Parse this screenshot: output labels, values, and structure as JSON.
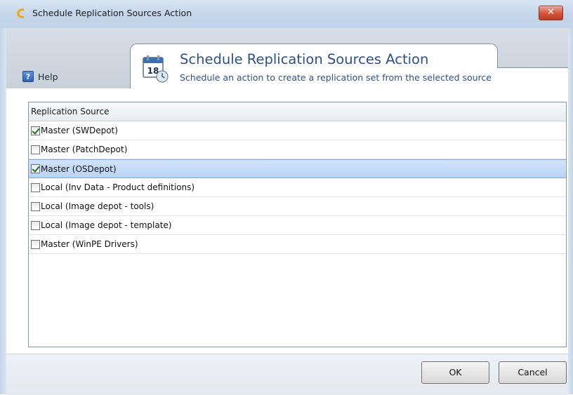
{
  "window": {
    "title": "Schedule Replication Sources Action",
    "close_glyph": "✕"
  },
  "header": {
    "help_label": "Help",
    "action_title": "Schedule Replication Sources Action",
    "action_subtitle": "Schedule an action to create a replication set from the selected source",
    "calendar_day": "18"
  },
  "grid": {
    "column_header": "Replication Source",
    "rows": [
      {
        "label": "Master (SWDepot)",
        "checked": true,
        "selected": false
      },
      {
        "label": "Master (PatchDepot)",
        "checked": false,
        "selected": false
      },
      {
        "label": "Master (OSDepot)",
        "checked": true,
        "selected": true
      },
      {
        "label": "Local (Inv Data - Product definitions)",
        "checked": false,
        "selected": false
      },
      {
        "label": "Local (Image depot - tools)",
        "checked": false,
        "selected": false
      },
      {
        "label": "Local (Image depot - template)",
        "checked": false,
        "selected": false
      },
      {
        "label": "Master (WinPE Drivers)",
        "checked": false,
        "selected": false
      }
    ]
  },
  "footer": {
    "ok_label": "OK",
    "cancel_label": "Cancel"
  },
  "icons": {
    "app": "app-c-logo-icon",
    "close": "close-icon",
    "help": "help-icon",
    "calendar": "calendar-icon",
    "checkbox": "checkbox-icon"
  },
  "colors": {
    "accent_text": "#2d4f8b",
    "selection": "#b9d4f3",
    "close_button": "#d2543d",
    "checkmark": "#1d6e1d"
  }
}
